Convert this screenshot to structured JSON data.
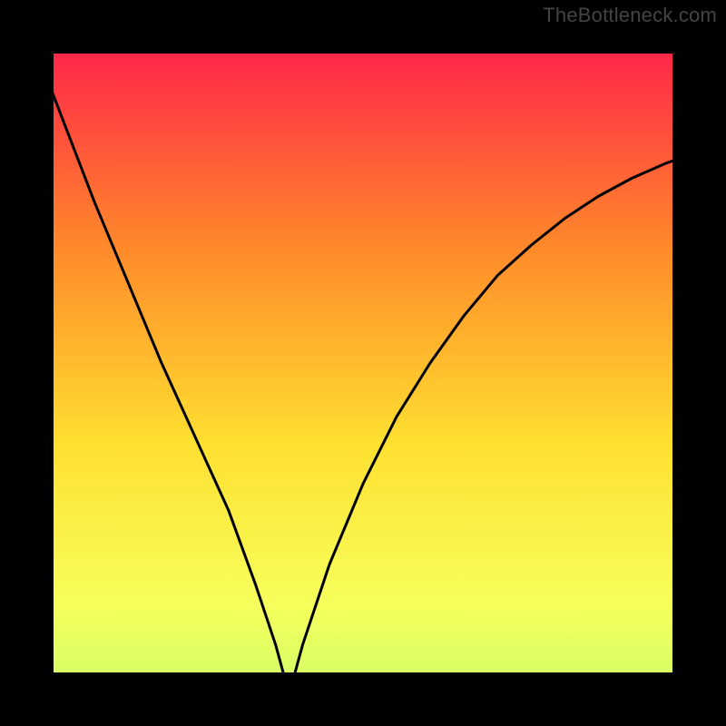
{
  "watermark": "TheBottleneck.com",
  "chart_data": {
    "type": "line",
    "title": "",
    "xlabel": "",
    "ylabel": "",
    "xlim": [
      0,
      100
    ],
    "ylim": [
      0,
      100
    ],
    "background_gradient": {
      "top": "#ff1a4d",
      "upper_mid": "#ff8a2a",
      "mid": "#ffe030",
      "lower_mid": "#f6ff5c",
      "bottom": "#00e676"
    },
    "marker": {
      "x": 39,
      "y": 0,
      "color": "#c0504d"
    },
    "series": [
      {
        "name": "bottleneck-curve",
        "x": [
          0,
          5,
          10,
          15,
          20,
          25,
          30,
          34,
          37,
          38.5,
          39,
          39.5,
          41,
          45,
          50,
          55,
          60,
          65,
          70,
          75,
          80,
          85,
          90,
          95,
          100
        ],
        "values": [
          100,
          87,
          74,
          62,
          50,
          39,
          28,
          17,
          8,
          2.5,
          0,
          2.5,
          8,
          20,
          32,
          42,
          50,
          57,
          63,
          67.5,
          71.5,
          74.8,
          77.5,
          79.7,
          81.5
        ]
      }
    ]
  },
  "frame": {
    "outer_size": 800,
    "border": 30
  }
}
